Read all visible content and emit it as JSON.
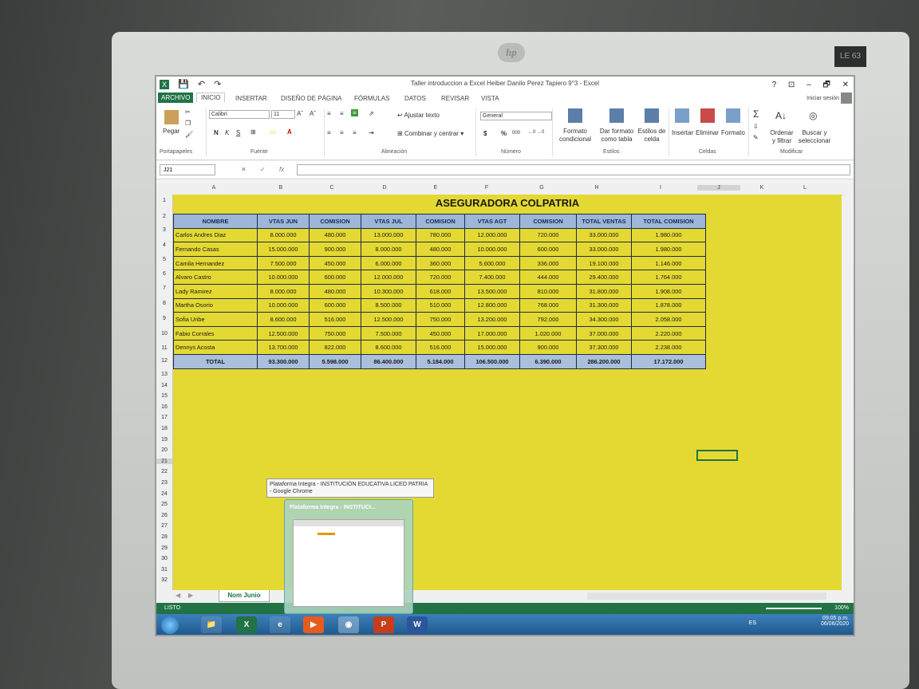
{
  "window": {
    "title": "Taller introduccion a Excel Heiber Danilo Perez Tapiero 9°3 - Excel",
    "controls": [
      "?",
      "⊡",
      "–",
      "🗗",
      "✕"
    ]
  },
  "monitor": {
    "brand": "hp",
    "model": "LE 63"
  },
  "ribbon_tabs": {
    "file": "ARCHIVO",
    "tabs": [
      "INICIO",
      "INSERTAR",
      "DISEÑO DE PÁGINA",
      "FÓRMULAS",
      "DATOS",
      "REVISAR",
      "VISTA"
    ],
    "active": "INICIO",
    "signin": "Iniciar sesión"
  },
  "ribbon": {
    "paste": "Pegar",
    "font_name": "Calibri",
    "font_size": "11",
    "bold": "N",
    "italic": "K",
    "underline": "S",
    "wrap_text": "Ajustar texto",
    "merge_center": "Combinar y centrar",
    "number_format": "General",
    "currency": "$",
    "percent": "%",
    "thousands": "000",
    "cond_format": "Formato condicional",
    "format_table": "Dar formato como tabla",
    "cell_styles": "Estilos de celda",
    "insert": "Insertar",
    "delete": "Eliminar",
    "format": "Formato",
    "sort_filter": "Ordenar y filtrar",
    "find_select": "Buscar y seleccionar",
    "groups": {
      "clipboard": "Portapapeles",
      "font": "Fuente",
      "alignment": "Alineación",
      "number": "Número",
      "styles": "Estilos",
      "cells": "Celdas",
      "editing": "Modificar"
    }
  },
  "formula_bar": {
    "name_box": "J21",
    "fx": "fx",
    "formula": ""
  },
  "columns": [
    "A",
    "B",
    "C",
    "D",
    "E",
    "F",
    "G",
    "H",
    "I",
    "J",
    "K",
    "L"
  ],
  "rows": [
    "1",
    "2",
    "3",
    "4",
    "5",
    "6",
    "7",
    "8",
    "9",
    "10",
    "11",
    "12",
    "13",
    "14",
    "15",
    "16",
    "17",
    "18",
    "19",
    "20",
    "21",
    "22",
    "23",
    "24",
    "25",
    "26",
    "27",
    "28",
    "29",
    "30",
    "31",
    "32"
  ],
  "sheet": {
    "title": "ASEGURADORA COLPATRIA",
    "headers": [
      "NOMBRE",
      "VTAS JUN",
      "COMISION",
      "VTAS JUL",
      "COMISION",
      "VTAS AGT",
      "COMISION",
      "TOTAL VENTAS",
      "TOTAL COMISION"
    ],
    "rows": [
      [
        "Carlos Andres Diaz",
        "8.000.000",
        "480.000",
        "13.000.000",
        "780.000",
        "12.000.000",
        "720.000",
        "33.000.000",
        "1.980.000"
      ],
      [
        "Fernando Casas",
        "15.000.000",
        "900.000",
        "8.000.000",
        "480.000",
        "10.000.000",
        "600.000",
        "33.000.000",
        "1.980.000"
      ],
      [
        "Camila Hernandez",
        "7.500.000",
        "450.000",
        "6.000.000",
        "360.000",
        "5.600.000",
        "336.000",
        "19.100.000",
        "1.146.000"
      ],
      [
        "Alvaro Castro",
        "10.000.000",
        "600.000",
        "12.000.000",
        "720.000",
        "7.400.000",
        "444.000",
        "29.400.000",
        "1.764.000"
      ],
      [
        "Lady Ramirez",
        "8.000.000",
        "480.000",
        "10.300.000",
        "618.000",
        "13.500.000",
        "810.000",
        "31.800.000",
        "1.908.000"
      ],
      [
        "Martha Osorio",
        "10.000.000",
        "600.000",
        "8.500.000",
        "510.000",
        "12.800.000",
        "768.000",
        "31.300.000",
        "1.878.000"
      ],
      [
        "Sofia Uribe",
        "8.600.000",
        "516.000",
        "12.500.000",
        "750.000",
        "13.200.000",
        "792.000",
        "34.300.000",
        "2.058.000"
      ],
      [
        "Fabio Corrales",
        "12.500.000",
        "750.000",
        "7.500.000",
        "450.000",
        "17.000.000",
        "1.020.000",
        "37.000.000",
        "2.220.000"
      ],
      [
        "Dennys Acosta",
        "13.700.000",
        "822.000",
        "8.600.000",
        "516.000",
        "15.000.000",
        "900.000",
        "37.300.000",
        "2.238.000"
      ]
    ],
    "total": [
      "TOTAL",
      "93.300.000",
      "5.598.000",
      "86.400.000",
      "5.184.000",
      "106.500.000",
      "6.390.000",
      "286.200.000",
      "17.172.000"
    ]
  },
  "sheet_tab": "Nom Junio",
  "status": {
    "ready": "LISTO",
    "zoom": "100%"
  },
  "taskbar": {
    "tooltip": "Plataforma Integra - INSTITUCIÓN EDUCATIVA LICEO PATRIA - Google Chrome",
    "preview_title": "Plataforma Integra - INSTITUCI...",
    "icons": [
      "explorer-icon",
      "excel-icon",
      "ie-icon",
      "media-icon",
      "chrome-icon",
      "powerpoint-icon",
      "word-icon"
    ],
    "lang": "ES",
    "time": "09:05 p.m.",
    "date": "06/06/2020"
  }
}
